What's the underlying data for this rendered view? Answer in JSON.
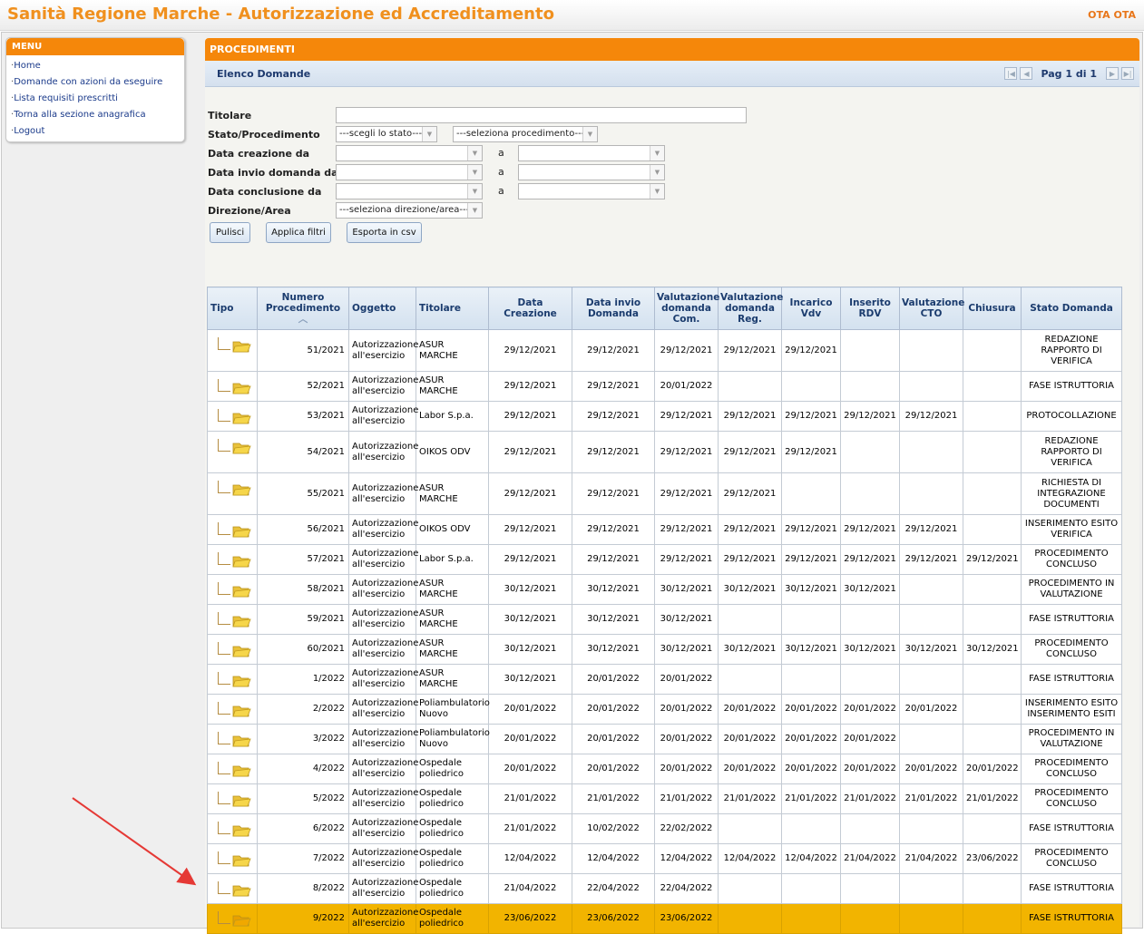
{
  "header": {
    "title": "Sanità Regione Marche - Autorizzazione ed Accreditamento",
    "user": "OTA OTA"
  },
  "menu": {
    "title": "MENU",
    "items": [
      "Home",
      "Domande con azioni da eseguire",
      "Lista requisiti prescritti",
      "Torna alla sezione anagrafica",
      "Logout"
    ]
  },
  "panel": {
    "title": "PROCEDIMENTI",
    "list_title": "Elenco Domande",
    "page_label": "Pag 1 di 1"
  },
  "filters": {
    "titolare_label": "Titolare",
    "stato_label": "Stato/Procedimento",
    "stato_select": "---scegli lo stato---",
    "procedimento_select": "---seleziona procedimento---",
    "data_creazione_label": "Data creazione da",
    "data_invio_label": "Data invio domanda da",
    "data_conclusione_label": "Data conclusione da",
    "a_label": "a",
    "direzione_label": "Direzione/Area",
    "direzione_select": "---seleziona direzione/area---"
  },
  "buttons": {
    "pulisci": "Pulisci",
    "applica": "Applica filtri",
    "esporta": "Esporta in csv"
  },
  "table": {
    "headers": [
      "Tipo",
      "Numero Procedimento",
      "Oggetto",
      "Titolare",
      "Data Creazione",
      "Data invio Domanda",
      "Valutazione domanda Com.",
      "Valutazione domanda Reg.",
      "Incarico Vdv",
      "Inserito RDV",
      "Valutazione CTO",
      "Chiusura",
      "Stato Domanda"
    ],
    "rows": [
      {
        "num": "51/2021",
        "oggetto": "Autorizzazione all'esercizio",
        "titolare": "ASUR MARCHE",
        "creazione": "29/12/2021",
        "invio": "29/12/2021",
        "val_com": "29/12/2021",
        "val_reg": "29/12/2021",
        "vdv": "29/12/2021",
        "rdv": "",
        "cto": "",
        "chiusura": "",
        "stato": "REDAZIONE RAPPORTO DI VERIFICA",
        "tall": true,
        "selected": false
      },
      {
        "num": "52/2021",
        "oggetto": "Autorizzazione all'esercizio",
        "titolare": "ASUR MARCHE",
        "creazione": "29/12/2021",
        "invio": "29/12/2021",
        "val_com": "20/01/2022",
        "val_reg": "",
        "vdv": "",
        "rdv": "",
        "cto": "",
        "chiusura": "",
        "stato": "FASE ISTRUTTORIA",
        "tall": false,
        "selected": false
      },
      {
        "num": "53/2021",
        "oggetto": "Autorizzazione all'esercizio",
        "titolare": "Labor S.p.a.",
        "creazione": "29/12/2021",
        "invio": "29/12/2021",
        "val_com": "29/12/2021",
        "val_reg": "29/12/2021",
        "vdv": "29/12/2021",
        "rdv": "29/12/2021",
        "cto": "29/12/2021",
        "chiusura": "",
        "stato": "PROTOCOLLAZIONE",
        "tall": false,
        "selected": false
      },
      {
        "num": "54/2021",
        "oggetto": "Autorizzazione all'esercizio",
        "titolare": "OIKOS ODV",
        "creazione": "29/12/2021",
        "invio": "29/12/2021",
        "val_com": "29/12/2021",
        "val_reg": "29/12/2021",
        "vdv": "29/12/2021",
        "rdv": "",
        "cto": "",
        "chiusura": "",
        "stato": "REDAZIONE RAPPORTO DI VERIFICA",
        "tall": true,
        "selected": false
      },
      {
        "num": "55/2021",
        "oggetto": "Autorizzazione all'esercizio",
        "titolare": "ASUR MARCHE",
        "creazione": "29/12/2021",
        "invio": "29/12/2021",
        "val_com": "29/12/2021",
        "val_reg": "29/12/2021",
        "vdv": "",
        "rdv": "",
        "cto": "",
        "chiusura": "",
        "stato": "RICHIESTA DI INTEGRAZIONE DOCUMENTI",
        "tall": true,
        "selected": false
      },
      {
        "num": "56/2021",
        "oggetto": "Autorizzazione all'esercizio",
        "titolare": "OIKOS ODV",
        "creazione": "29/12/2021",
        "invio": "29/12/2021",
        "val_com": "29/12/2021",
        "val_reg": "29/12/2021",
        "vdv": "29/12/2021",
        "rdv": "29/12/2021",
        "cto": "29/12/2021",
        "chiusura": "",
        "stato": "INSERIMENTO ESITO VERIFICA",
        "tall": false,
        "selected": false
      },
      {
        "num": "57/2021",
        "oggetto": "Autorizzazione all'esercizio",
        "titolare": "Labor S.p.a.",
        "creazione": "29/12/2021",
        "invio": "29/12/2021",
        "val_com": "29/12/2021",
        "val_reg": "29/12/2021",
        "vdv": "29/12/2021",
        "rdv": "29/12/2021",
        "cto": "29/12/2021",
        "chiusura": "29/12/2021",
        "stato": "PROCEDIMENTO CONCLUSO",
        "tall": false,
        "selected": false
      },
      {
        "num": "58/2021",
        "oggetto": "Autorizzazione all'esercizio",
        "titolare": "ASUR MARCHE",
        "creazione": "30/12/2021",
        "invio": "30/12/2021",
        "val_com": "30/12/2021",
        "val_reg": "30/12/2021",
        "vdv": "30/12/2021",
        "rdv": "30/12/2021",
        "cto": "",
        "chiusura": "",
        "stato": "PROCEDIMENTO IN VALUTAZIONE",
        "tall": false,
        "selected": false
      },
      {
        "num": "59/2021",
        "oggetto": "Autorizzazione all'esercizio",
        "titolare": "ASUR MARCHE",
        "creazione": "30/12/2021",
        "invio": "30/12/2021",
        "val_com": "30/12/2021",
        "val_reg": "",
        "vdv": "",
        "rdv": "",
        "cto": "",
        "chiusura": "",
        "stato": "FASE ISTRUTTORIA",
        "tall": false,
        "selected": false
      },
      {
        "num": "60/2021",
        "oggetto": "Autorizzazione all'esercizio",
        "titolare": "ASUR MARCHE",
        "creazione": "30/12/2021",
        "invio": "30/12/2021",
        "val_com": "30/12/2021",
        "val_reg": "30/12/2021",
        "vdv": "30/12/2021",
        "rdv": "30/12/2021",
        "cto": "30/12/2021",
        "chiusura": "30/12/2021",
        "stato": "PROCEDIMENTO CONCLUSO",
        "tall": false,
        "selected": false
      },
      {
        "num": "1/2022",
        "oggetto": "Autorizzazione all'esercizio",
        "titolare": "ASUR MARCHE",
        "creazione": "30/12/2021",
        "invio": "20/01/2022",
        "val_com": "20/01/2022",
        "val_reg": "",
        "vdv": "",
        "rdv": "",
        "cto": "",
        "chiusura": "",
        "stato": "FASE ISTRUTTORIA",
        "tall": false,
        "selected": false
      },
      {
        "num": "2/2022",
        "oggetto": "Autorizzazione all'esercizio",
        "titolare": "Poliambulatorio Nuovo",
        "creazione": "20/01/2022",
        "invio": "20/01/2022",
        "val_com": "20/01/2022",
        "val_reg": "20/01/2022",
        "vdv": "20/01/2022",
        "rdv": "20/01/2022",
        "cto": "20/01/2022",
        "chiusura": "",
        "stato": "INSERIMENTO ESITO INSERIMENTO ESITI",
        "tall": false,
        "selected": false
      },
      {
        "num": "3/2022",
        "oggetto": "Autorizzazione all'esercizio",
        "titolare": "Poliambulatorio Nuovo",
        "creazione": "20/01/2022",
        "invio": "20/01/2022",
        "val_com": "20/01/2022",
        "val_reg": "20/01/2022",
        "vdv": "20/01/2022",
        "rdv": "20/01/2022",
        "cto": "",
        "chiusura": "",
        "stato": "PROCEDIMENTO IN VALUTAZIONE",
        "tall": false,
        "selected": false
      },
      {
        "num": "4/2022",
        "oggetto": "Autorizzazione all'esercizio",
        "titolare": "Ospedale poliedrico",
        "creazione": "20/01/2022",
        "invio": "20/01/2022",
        "val_com": "20/01/2022",
        "val_reg": "20/01/2022",
        "vdv": "20/01/2022",
        "rdv": "20/01/2022",
        "cto": "20/01/2022",
        "chiusura": "20/01/2022",
        "stato": "PROCEDIMENTO CONCLUSO",
        "tall": false,
        "selected": false
      },
      {
        "num": "5/2022",
        "oggetto": "Autorizzazione all'esercizio",
        "titolare": "Ospedale poliedrico",
        "creazione": "21/01/2022",
        "invio": "21/01/2022",
        "val_com": "21/01/2022",
        "val_reg": "21/01/2022",
        "vdv": "21/01/2022",
        "rdv": "21/01/2022",
        "cto": "21/01/2022",
        "chiusura": "21/01/2022",
        "stato": "PROCEDIMENTO CONCLUSO",
        "tall": false,
        "selected": false
      },
      {
        "num": "6/2022",
        "oggetto": "Autorizzazione all'esercizio",
        "titolare": "Ospedale poliedrico",
        "creazione": "21/01/2022",
        "invio": "10/02/2022",
        "val_com": "22/02/2022",
        "val_reg": "",
        "vdv": "",
        "rdv": "",
        "cto": "",
        "chiusura": "",
        "stato": "FASE ISTRUTTORIA",
        "tall": false,
        "selected": false
      },
      {
        "num": "7/2022",
        "oggetto": "Autorizzazione all'esercizio",
        "titolare": "Ospedale poliedrico",
        "creazione": "12/04/2022",
        "invio": "12/04/2022",
        "val_com": "12/04/2022",
        "val_reg": "12/04/2022",
        "vdv": "12/04/2022",
        "rdv": "21/04/2022",
        "cto": "21/04/2022",
        "chiusura": "23/06/2022",
        "stato": "PROCEDIMENTO CONCLUSO",
        "tall": false,
        "selected": false
      },
      {
        "num": "8/2022",
        "oggetto": "Autorizzazione all'esercizio",
        "titolare": "Ospedale poliedrico",
        "creazione": "21/04/2022",
        "invio": "22/04/2022",
        "val_com": "22/04/2022",
        "val_reg": "",
        "vdv": "",
        "rdv": "",
        "cto": "",
        "chiusura": "",
        "stato": "FASE ISTRUTTORIA",
        "tall": false,
        "selected": false
      },
      {
        "num": "9/2022",
        "oggetto": "Autorizzazione all'esercizio",
        "titolare": "Ospedale poliedrico",
        "creazione": "23/06/2022",
        "invio": "23/06/2022",
        "val_com": "23/06/2022",
        "val_reg": "",
        "vdv": "",
        "rdv": "",
        "cto": "",
        "chiusura": "",
        "stato": "FASE ISTRUTTORIA",
        "tall": false,
        "selected": true
      }
    ]
  },
  "colors": {
    "accent": "#f5870a",
    "selected_row": "#f2b400",
    "annotation_arrow": "#e53935"
  }
}
